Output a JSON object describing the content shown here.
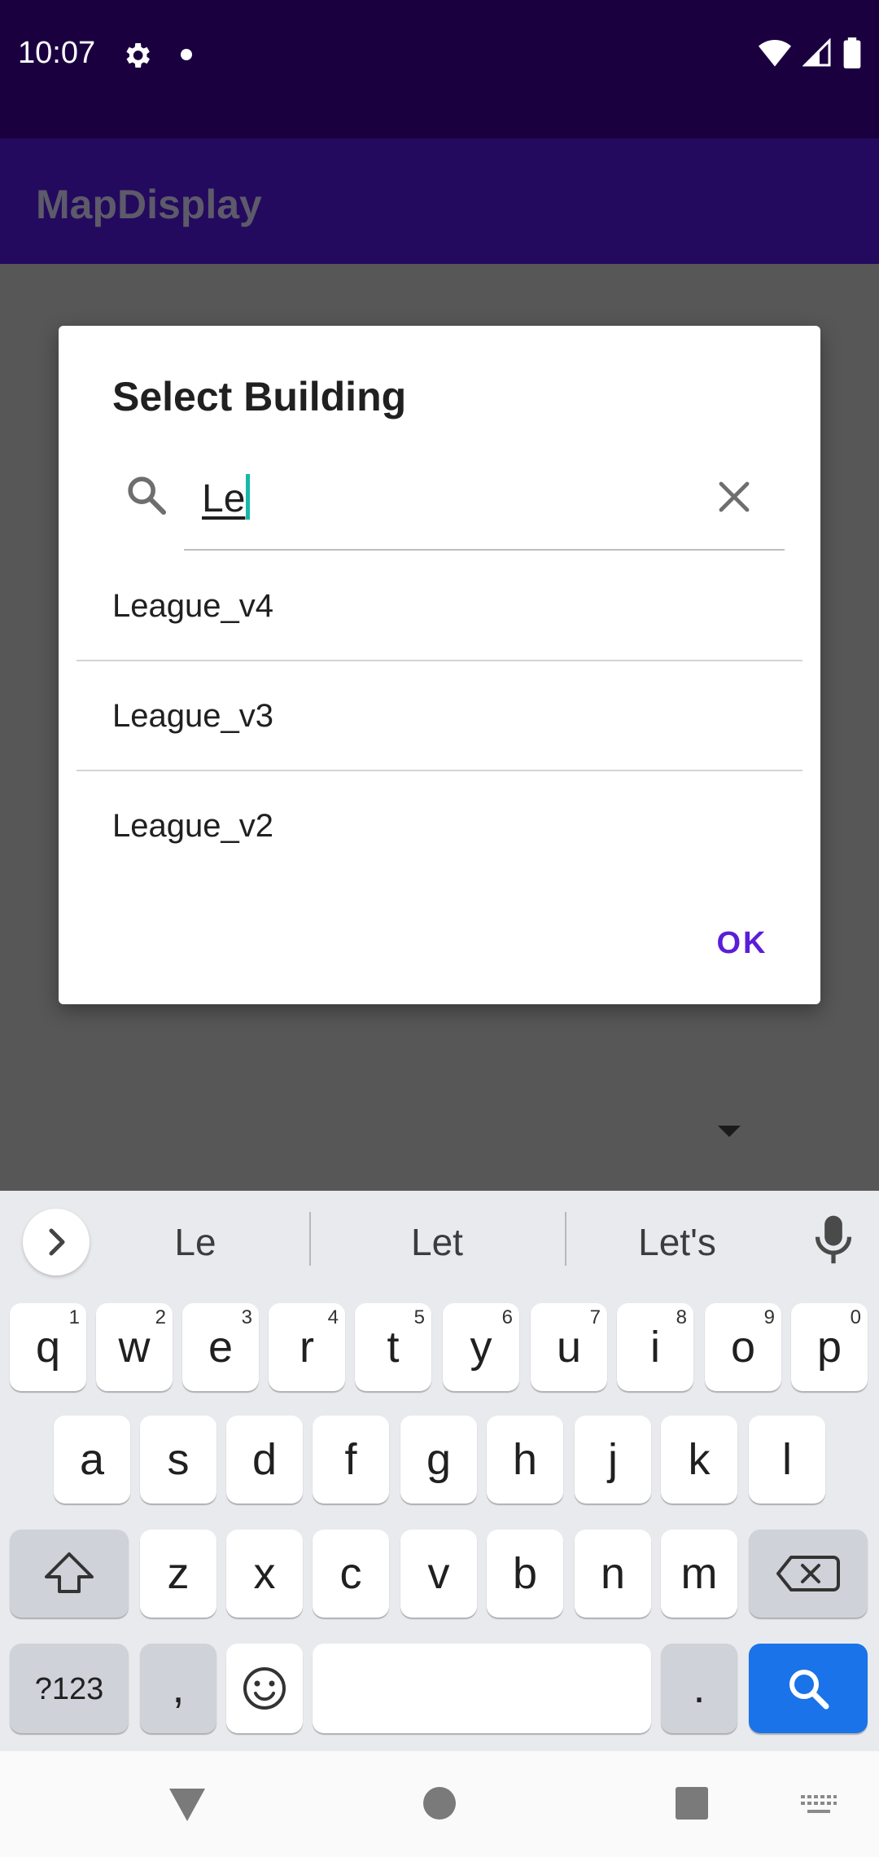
{
  "status_bar": {
    "time": "10:07"
  },
  "app_bar": {
    "title": "MapDisplay"
  },
  "dialog": {
    "title": "Select Building",
    "search_value": "Le",
    "items": [
      "League_v4",
      "League_v3",
      "League_v2"
    ],
    "ok_label": "OK"
  },
  "keyboard": {
    "suggestions": [
      "Le",
      "Let",
      "Let's"
    ],
    "row1": [
      {
        "key": "q",
        "num": "1"
      },
      {
        "key": "w",
        "num": "2"
      },
      {
        "key": "e",
        "num": "3"
      },
      {
        "key": "r",
        "num": "4"
      },
      {
        "key": "t",
        "num": "5"
      },
      {
        "key": "y",
        "num": "6"
      },
      {
        "key": "u",
        "num": "7"
      },
      {
        "key": "i",
        "num": "8"
      },
      {
        "key": "o",
        "num": "9"
      },
      {
        "key": "p",
        "num": "0"
      }
    ],
    "row2": [
      "a",
      "s",
      "d",
      "f",
      "g",
      "h",
      "j",
      "k",
      "l"
    ],
    "row3": [
      "z",
      "x",
      "c",
      "v",
      "b",
      "n",
      "m"
    ],
    "symbols_label": "?123",
    "comma_label": ",",
    "period_label": "."
  },
  "colors": {
    "status_bar": "#1b0040",
    "app_bar": "#240a5e",
    "accent": "#5a1ed8",
    "keyboard_search": "#1a73e8"
  }
}
